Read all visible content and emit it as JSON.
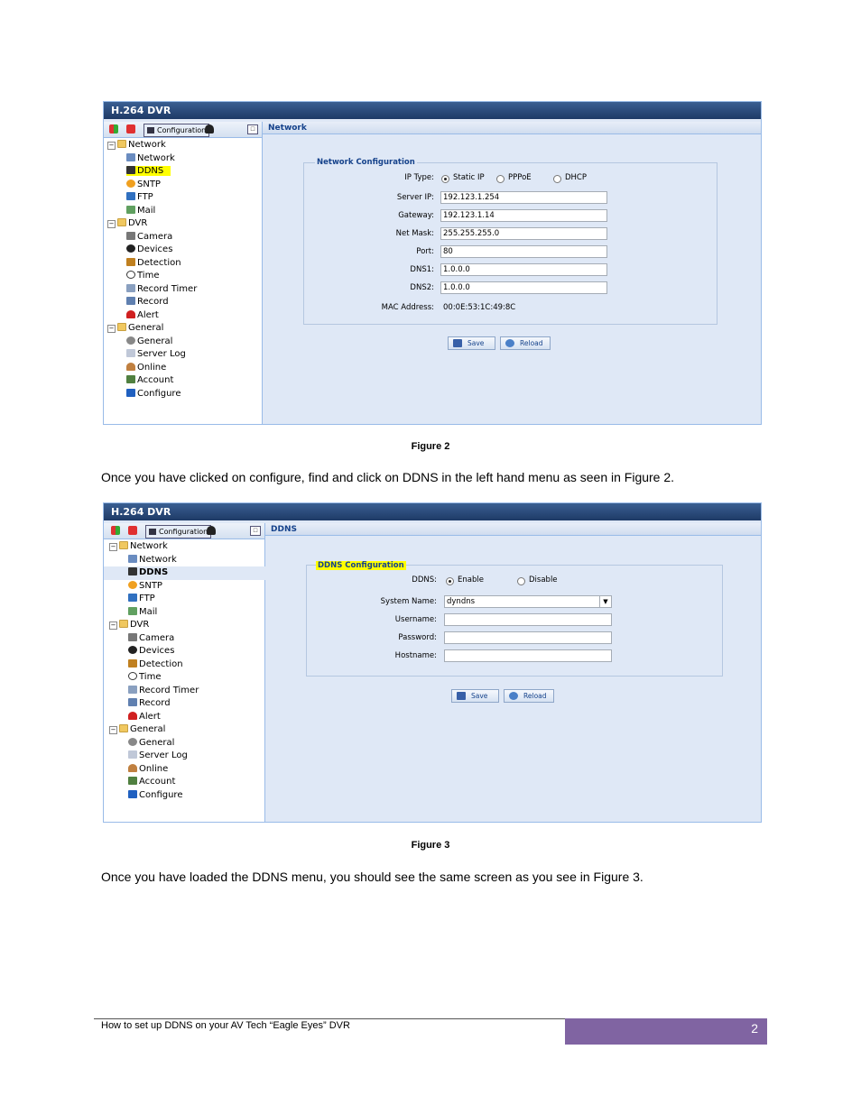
{
  "figure2": {
    "app_title": "H.264 DVR",
    "toolbar_configuration": "Configuration",
    "panel_title": "Network",
    "legend": "Network Configuration",
    "tree": {
      "network_group": "Network",
      "network_items": [
        "Network",
        "DDNS",
        "SNTP",
        "FTP",
        "Mail"
      ],
      "dvr_group": "DVR",
      "dvr_items": [
        "Camera",
        "Devices",
        "Detection",
        "Time",
        "Record Timer",
        "Record",
        "Alert"
      ],
      "general_group": "General",
      "general_items": [
        "General",
        "Server Log",
        "Online",
        "Account",
        "Configure"
      ]
    },
    "ip_type_label": "IP Type:",
    "ip_type_options": [
      "Static IP",
      "PPPoE",
      "DHCP"
    ],
    "ip_type_selected": "Static IP",
    "fields": [
      {
        "label": "Server IP:",
        "value": "192.123.1.254"
      },
      {
        "label": "Gateway:",
        "value": "192.123.1.14"
      },
      {
        "label": "Net Mask:",
        "value": "255.255.255.0"
      },
      {
        "label": "Port:",
        "value": "80"
      },
      {
        "label": "DNS1:",
        "value": "1.0.0.0"
      },
      {
        "label": "DNS2:",
        "value": "1.0.0.0"
      }
    ],
    "mac_label": "MAC Address:",
    "mac_value": "00:0E:53:1C:49:8C",
    "save_label": "Save",
    "reload_label": "Reload",
    "highlight_color": "#ffff00"
  },
  "caption2": "Figure 2",
  "paragraph1": "Once you have clicked on configure, find and click on DDNS in the left hand menu as seen in Figure 2.",
  "figure3": {
    "app_title": "H.264 DVR",
    "toolbar_configuration": "Configuration",
    "panel_title": "DDNS",
    "legend": "DDNS Configuration",
    "tree": {
      "network_group": "Network",
      "network_items": [
        "Network",
        "DDNS",
        "SNTP",
        "FTP",
        "Mail"
      ],
      "dvr_group": "DVR",
      "dvr_items": [
        "Camera",
        "Devices",
        "Detection",
        "Time",
        "Record Timer",
        "Record",
        "Alert"
      ],
      "general_group": "General",
      "general_items": [
        "General",
        "Server Log",
        "Online",
        "Account",
        "Configure"
      ]
    },
    "ddns_label": "DDNS:",
    "ddns_options": [
      "Enable",
      "Disable"
    ],
    "ddns_selected": "Enable",
    "system_name_label": "System Name:",
    "system_name_value": "dyndns",
    "username_label": "Username:",
    "username_value": "",
    "password_label": "Password:",
    "password_value": "",
    "hostname_label": "Hostname:",
    "hostname_value": "",
    "save_label": "Save",
    "reload_label": "Reload"
  },
  "caption3": "Figure 3",
  "paragraph2": "Once you have loaded the DDNS menu, you should see the same screen as you see in Figure 3.",
  "footer": {
    "text": "How to set up DDNS on your AV Tech “Eagle Eyes” DVR",
    "page_number": "2",
    "accent_color": "#8064a2"
  }
}
